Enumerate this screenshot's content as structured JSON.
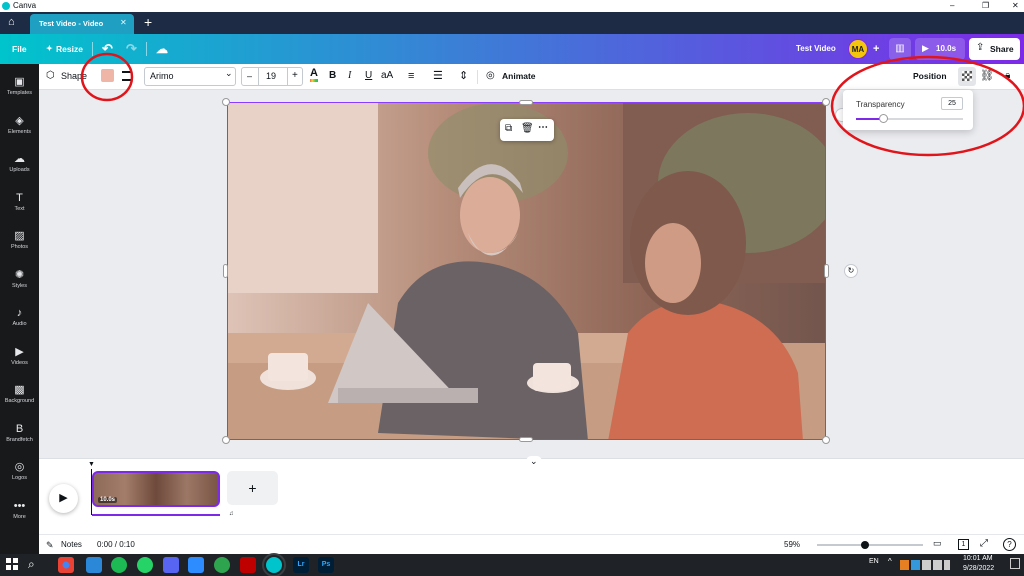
{
  "window": {
    "app_name": "Canva",
    "minimize": "–",
    "maximize": "❐",
    "close": "✕"
  },
  "tab": {
    "title": "Test Video - Video",
    "close": "✕",
    "new_tab": "+"
  },
  "topbar": {
    "file": "File",
    "resize": "Resize",
    "undo": "↶",
    "redo": "↷",
    "project_name": "Test Video",
    "avatar_initials": "MA",
    "add_member": "+",
    "duration": "10.0s",
    "share": "Share"
  },
  "toolbar": {
    "shape": "Shape",
    "shape_color": "#efb5a7",
    "font": "Arimo",
    "font_dd": "⌄",
    "font_size": "19",
    "minus": "–",
    "plus": "+",
    "text_color_glyph": "A",
    "bold": "B",
    "italic": "I",
    "underline": "U",
    "case": "aA",
    "animate": "Animate",
    "position": "Position"
  },
  "transparency": {
    "label": "Transparency",
    "value": "25",
    "level": 0.25
  },
  "sidebar": [
    {
      "icon": "templates-icon",
      "glyph": "▣",
      "label": "Templates"
    },
    {
      "icon": "elements-icon",
      "glyph": "◈",
      "label": "Elements"
    },
    {
      "icon": "uploads-icon",
      "glyph": "☁",
      "label": "Uploads"
    },
    {
      "icon": "text-icon",
      "glyph": "T",
      "label": "Text"
    },
    {
      "icon": "photos-icon",
      "glyph": "▨",
      "label": "Photos"
    },
    {
      "icon": "styles-icon",
      "glyph": "✺",
      "label": "Styles"
    },
    {
      "icon": "audio-icon",
      "glyph": "♪",
      "label": "Audio"
    },
    {
      "icon": "videos-icon",
      "glyph": "▶",
      "label": "Videos"
    },
    {
      "icon": "background-icon",
      "glyph": "▩",
      "label": "Background"
    },
    {
      "icon": "brandfetch-icon",
      "glyph": "B",
      "label": "Brandfetch"
    },
    {
      "icon": "logos-icon",
      "glyph": "◎",
      "label": "Logos"
    },
    {
      "icon": "more-icon",
      "glyph": "•••",
      "label": "More"
    }
  ],
  "timeline": {
    "play": "▶",
    "clip_duration": "10.0s",
    "add": "+",
    "collapse": "⌄"
  },
  "footer": {
    "notes": "Notes",
    "time": "0:00 / 0:10",
    "zoom": "59%",
    "page_count": "1",
    "help": "?"
  },
  "taskbar": {
    "search": "⌕",
    "lang": "EN",
    "clock_time": "10:01 AM",
    "clock_date": "9/28/2022",
    "tray_up": "^"
  },
  "annotations": {
    "color": "#e0151b"
  }
}
